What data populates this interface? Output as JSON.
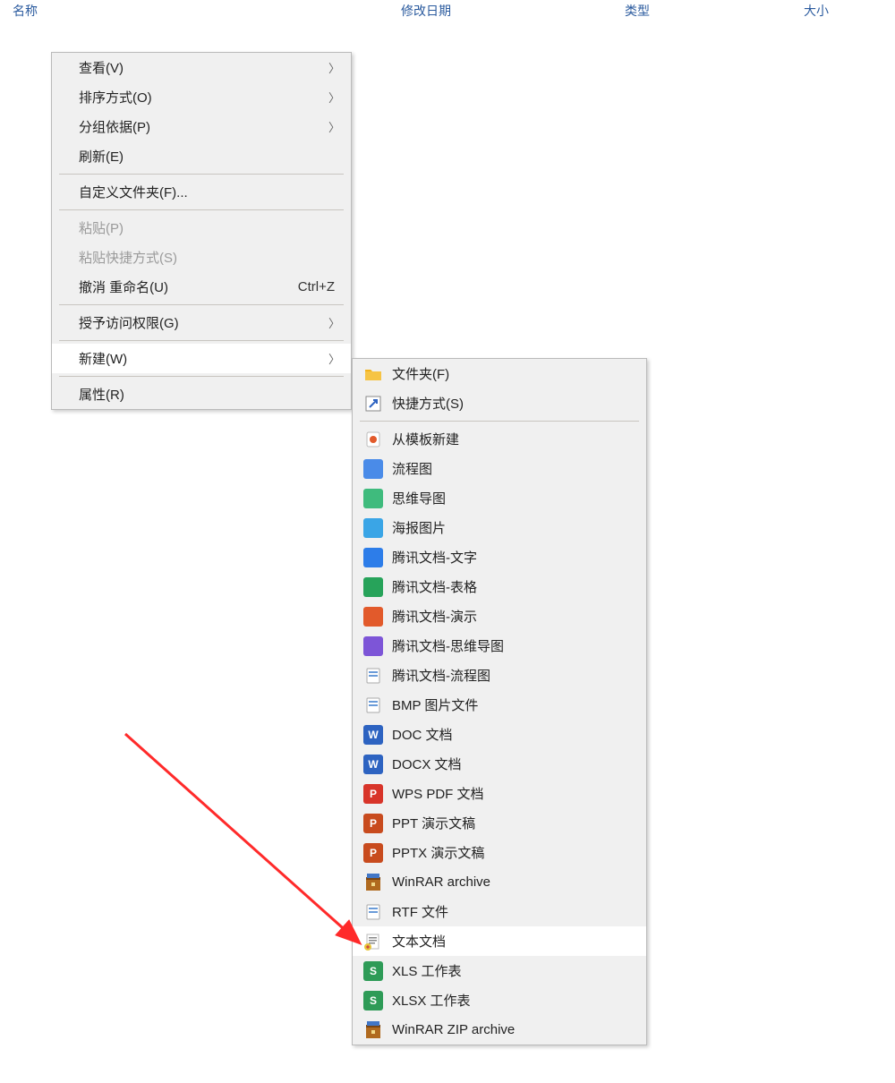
{
  "header": {
    "name": "名称",
    "date": "修改日期",
    "type": "类型",
    "size": "大小"
  },
  "menu1": {
    "view": "查看(V)",
    "sort": "排序方式(O)",
    "group": "分组依据(P)",
    "refresh": "刷新(E)",
    "customize": "自定义文件夹(F)...",
    "paste": "粘贴(P)",
    "paste_shortcut": "粘贴快捷方式(S)",
    "undo": "撤消 重命名(U)",
    "undo_key": "Ctrl+Z",
    "grant_access": "授予访问权限(G)",
    "new": "新建(W)",
    "properties": "属性(R)"
  },
  "menu2": {
    "items": [
      {
        "icon": "folder",
        "bg": "#f6c445",
        "glyph": "",
        "label": "文件夹(F)"
      },
      {
        "icon": "shortcut",
        "bg": "#fff",
        "glyph": "",
        "label": "快捷方式(S)"
      },
      {
        "sep": true
      },
      {
        "icon": "template",
        "bg": "#fff",
        "glyph": "",
        "label": "从模板新建"
      },
      {
        "icon": "flowchart",
        "bg": "#4a8be8",
        "glyph": "",
        "label": "流程图"
      },
      {
        "icon": "mindmap",
        "bg": "#3fbb7d",
        "glyph": "",
        "label": "思维导图"
      },
      {
        "icon": "poster",
        "bg": "#3aa5e6",
        "glyph": "",
        "label": "海报图片"
      },
      {
        "icon": "tencent-doc",
        "bg": "#2d7de9",
        "glyph": "",
        "label": "腾讯文档-文字"
      },
      {
        "icon": "tencent-sheet",
        "bg": "#27a35a",
        "glyph": "",
        "label": "腾讯文档-表格"
      },
      {
        "icon": "tencent-ppt",
        "bg": "#e25a2b",
        "glyph": "",
        "label": "腾讯文档-演示"
      },
      {
        "icon": "tencent-mind",
        "bg": "#7d55d7",
        "glyph": "",
        "label": "腾讯文档-思维导图"
      },
      {
        "icon": "tencent-flow",
        "bg": "#fff",
        "glyph": "",
        "label": "腾讯文档-流程图"
      },
      {
        "icon": "bmp",
        "bg": "#fff",
        "glyph": "",
        "label": "BMP 图片文件"
      },
      {
        "icon": "doc",
        "bg": "#2d63c1",
        "glyph": "W",
        "label": "DOC 文档"
      },
      {
        "icon": "docx",
        "bg": "#2d63c1",
        "glyph": "W",
        "label": "DOCX 文档"
      },
      {
        "icon": "wps-pdf",
        "bg": "#d8352a",
        "glyph": "P",
        "label": "WPS PDF 文档"
      },
      {
        "icon": "ppt",
        "bg": "#c84b1e",
        "glyph": "P",
        "label": "PPT 演示文稿"
      },
      {
        "icon": "pptx",
        "bg": "#c84b1e",
        "glyph": "P",
        "label": "PPTX 演示文稿"
      },
      {
        "icon": "rar",
        "bg": "#8b5a2b",
        "glyph": "",
        "label": "WinRAR archive"
      },
      {
        "icon": "rtf",
        "bg": "#fff",
        "glyph": "",
        "label": "RTF 文件"
      },
      {
        "icon": "txt",
        "bg": "#fff",
        "glyph": "",
        "label": "文本文档",
        "hl": true
      },
      {
        "icon": "xls",
        "bg": "#2e9b57",
        "glyph": "S",
        "label": "XLS 工作表"
      },
      {
        "icon": "xlsx",
        "bg": "#2e9b57",
        "glyph": "S",
        "label": "XLSX 工作表"
      },
      {
        "icon": "zip",
        "bg": "#8b5a2b",
        "glyph": "",
        "label": "WinRAR ZIP archive"
      }
    ]
  }
}
